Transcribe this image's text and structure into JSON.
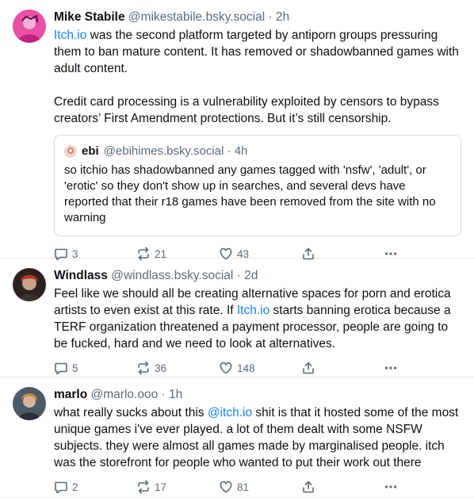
{
  "posts": [
    {
      "author": "Mike Stabile",
      "handle": "@mikestabile.bsky.social",
      "sep": " · ",
      "time": "2h",
      "para1_link": "Itch.io",
      "para1_rest": " was the second platform targeted by antiporn groups pressuring them to ban mature content. It has removed or shadowbanned games with adult content.",
      "para2": "Credit card processing is a vulnerability exploited by censors to bypass creators’ First Amendment protections. But it’s still censorship.",
      "quote": {
        "author": "ebi",
        "handle": "@ebihimes.bsky.social",
        "sep": " · ",
        "time": "4h",
        "text": "so itchio has shadowbanned any games tagged with 'nsfw', 'adult', or 'erotic' so they don't show up in searches, and several devs have reported that their r18 games have been removed from the site with no warning"
      },
      "stats": {
        "replies": "3",
        "reposts": "21",
        "likes": "43"
      }
    },
    {
      "author": "Windlass",
      "handle": "@windlass.bsky.social",
      "sep": " · ",
      "time": "2d",
      "text_before": "Feel like we should all be creating alternative spaces for porn and erotica artists to even exist at this rate. If ",
      "text_link": "Itch.io",
      "text_after": " starts banning erotica because a TERF organization threatened a payment processor, people are going to be fucked, hard and we need to look at alternatives.",
      "stats": {
        "replies": "5",
        "reposts": "36",
        "likes": "148"
      }
    },
    {
      "author": "marlo",
      "handle": "@marlo.ooo",
      "sep": " · ",
      "time": "1h",
      "text_before": "what really sucks about this ",
      "text_link": "@itch.io",
      "text_after": " shit is that it hosted some of the most unique games i've ever played. a lot of them dealt with some NSFW subjects. they were almost all games made by marginalised people. itch was the storefront for people who wanted to put their work out there",
      "stats": {
        "replies": "2",
        "reposts": "17",
        "likes": "81"
      }
    }
  ],
  "icons": {
    "reply": "reply-icon",
    "repost": "repost-icon",
    "like": "heart-icon",
    "share": "share-icon",
    "more": "more-icon"
  },
  "colors": {
    "link": "#1083fe",
    "muted": "#5b6b7b",
    "border": "#e6e8eb"
  }
}
